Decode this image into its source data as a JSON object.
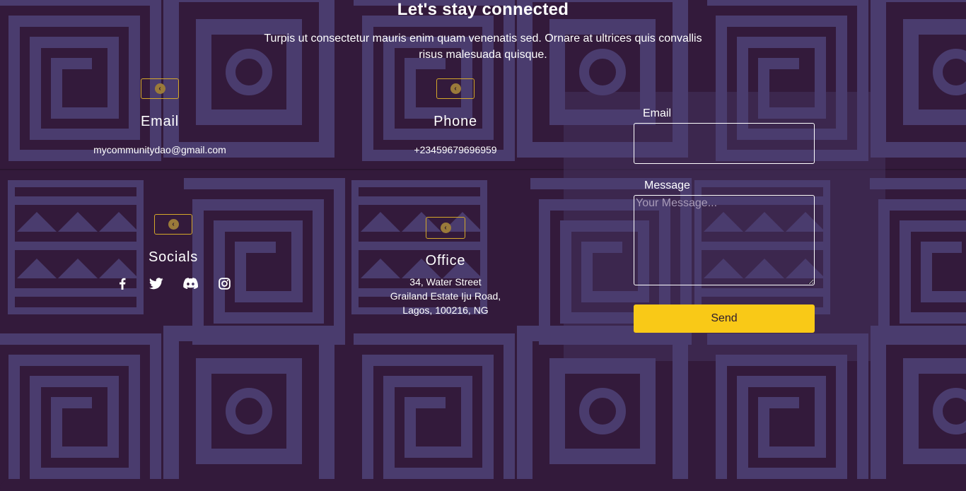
{
  "header": {
    "title": "Let's stay connected",
    "subtitle_line1": "Turpis ut consectetur mauris enim quam venenatis sed. Ornare at ultrices quis convallis",
    "subtitle_line2": "risus malesuada quisque."
  },
  "cards": {
    "email": {
      "title": "Email",
      "value": "mycommunitydao@gmail.com"
    },
    "phone": {
      "title": "Phone",
      "value": "+23459679696959"
    },
    "socials": {
      "title": "Socials",
      "links": [
        "facebook-icon",
        "twitter-icon",
        "discord-icon",
        "instagram-icon"
      ]
    },
    "office": {
      "title": "Office",
      "line1": "34, Water Street",
      "line2": "Grailand Estate Iju Road,",
      "line3": "Lagos, 100216, NG"
    }
  },
  "form": {
    "email_label": "Email",
    "email_value": "",
    "message_label": "Message",
    "message_placeholder": "Your Message...",
    "send_label": "Send"
  },
  "colors": {
    "background": "#331a3b",
    "pattern": "#4a3c6e",
    "accent": "#f9c917",
    "icon_border": "#d4a82a"
  },
  "card_icon": "chevron-left-icon"
}
